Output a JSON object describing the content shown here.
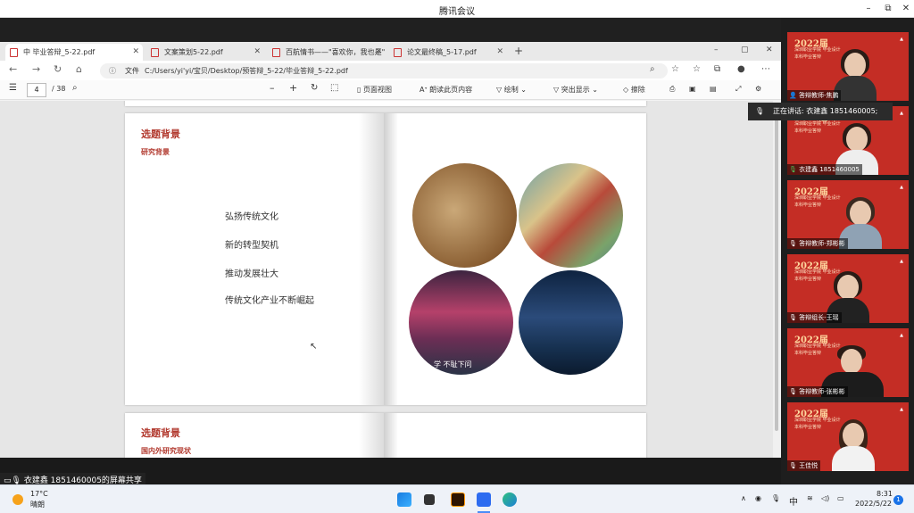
{
  "window": {
    "title": "腾讯会议",
    "minimize": "–",
    "restore": "⧉",
    "close": "✕"
  },
  "browser": {
    "tabs": [
      {
        "label": "中 毕业答辩_5-22.pdf",
        "active": true
      },
      {
        "label": "文案策划5-22.pdf",
        "active": false
      },
      {
        "label": "百航情书——\"喜欢你，我也是\"...",
        "active": false
      },
      {
        "label": "论文最终稿_5-17.pdf",
        "active": false
      }
    ],
    "new_tab": "+",
    "address": {
      "info_label": "文件",
      "url": "C:/Users/yi'yi/宝贝/Desktop/预答辩_5-22/毕业答辩_5-22.pdf"
    },
    "pdf_toolbar": {
      "page_current": "4",
      "page_total": "/ 38",
      "page_view": "页面视图",
      "read_aloud": "朗读此页内容",
      "draw": "绘制",
      "highlight": "突出显示",
      "erase": "擦除"
    }
  },
  "document": {
    "page1": {
      "heading": "选题背景",
      "subheading": "研究背景",
      "bullets": [
        "弘扬传统文化",
        "新的转型契机",
        "推动发展壮大",
        "传统文化产业不断崛起"
      ],
      "photo_caption": "学 不耻下问"
    },
    "page2": {
      "heading": "选题背景",
      "subheading": "国内外研究现状"
    }
  },
  "meeting": {
    "speaking_label": "正在讲话: 衣建鑫 1851460005;",
    "screen_share_label": "衣建鑫 1851460005的屏幕共享",
    "banner": {
      "year": "2022届",
      "line1": "深圳职业学院 毕业设计",
      "line2": "本科毕业答辩"
    },
    "participants": [
      {
        "name": "答辩教师-焦鹏"
      },
      {
        "name": "衣建鑫 1851460005"
      },
      {
        "name": "答辩教师-郑彬彬"
      },
      {
        "name": "答辩组长-王瑶"
      },
      {
        "name": "答辩教师-张彬彬"
      },
      {
        "name": "王佳悦"
      }
    ]
  },
  "taskbar": {
    "weather_temp": "17°C",
    "weather_desc": "晴朗",
    "ime": "中",
    "time": "8:31",
    "date": "2022/5/22",
    "notification_count": "1"
  },
  "colors": {
    "accent_red": "#b23a2f",
    "tile_red": "#c42d25"
  }
}
